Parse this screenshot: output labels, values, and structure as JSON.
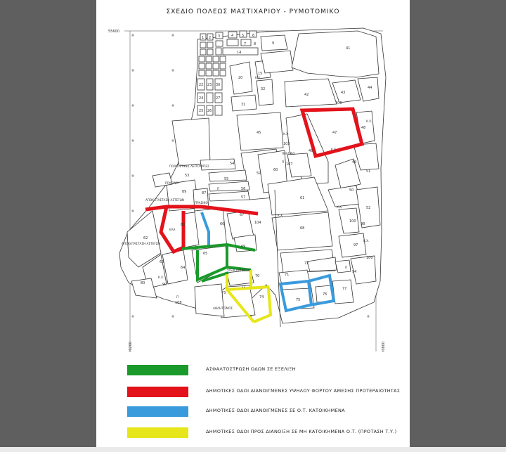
{
  "map": {
    "title": "ΣΧΕΔΙΟ ΠΟΛΕΩΣ ΜΑΣΤΙΧΑΡΙΟΥ   -   ΡΥΜΟΤΟΜΙΚΟ",
    "coord_top_left": "55600",
    "coord_bottom_left": "290200",
    "coord_bottom_right": "290800",
    "labels": {
      "politistiko": "ΠΟΛΙΤΙΣΤΙΚΕΣ ΛΕΙΤΟΥΡΓΙΕΣ",
      "prasino": "ΠΡΑΣΙΝΟ",
      "apokatastasi": "ΑΠΟΚΑΤΑΣΤΑΣΗ ΑΣΤΕΓΩΝ",
      "apokatastasi2": "ΑΠΟΚΑΤΑΣΤΑΣΗ ΑΣΤΕΓΩΝ",
      "ela": "ΕΛΑ",
      "ygeia": "ΥΓΕΙΑ ΠΡΟΝΟΙΑ",
      "athlitismos": "ΑΘΛΗΤΙΣΜΟΣ",
      "kx": "Κ.Χ.",
      "p": "Π"
    },
    "blocks": [
      "1",
      "2",
      "3",
      "4",
      "5",
      "6",
      "7",
      "8",
      "9",
      "14",
      "15",
      "20",
      "22",
      "23",
      "24",
      "25",
      "26",
      "27",
      "30",
      "31",
      "32",
      "41",
      "42",
      "43",
      "44",
      "45",
      "46",
      "47",
      "48",
      "49",
      "50",
      "51",
      "52",
      "53",
      "54",
      "55",
      "56",
      "57",
      "58",
      "59",
      "60",
      "61",
      "62",
      "63",
      "64",
      "65",
      "66",
      "67",
      "68",
      "69",
      "70",
      "71",
      "72",
      "73",
      "74",
      "75",
      "76",
      "77",
      "80",
      "86",
      "87",
      "89",
      "90",
      "94",
      "97",
      "98",
      "100",
      "103",
      "104",
      "106",
      "107",
      "108"
    ]
  },
  "legend": [
    {
      "color": "#1a9a2a",
      "text": "ΑΣΦΑΛΤΟΣΤΡΩΣΗ ΟΔΩΝ ΣΕ ΕΞΕΛΙΞΗ"
    },
    {
      "color": "#e3121b",
      "text": "ΔΗΜΟΤΙΚΕΣ ΟΔΟΙ ΔΙΑΝΟΙΓΜΕΝΕΣ ΥΨΗΛΟΥ ΦΟΡΤΟΥ ΑΜΕΣΗΣ ΠΡΟΤΕΡΑΙΟΤΗΤΑΣ"
    },
    {
      "color": "#3a9bdc",
      "text": "ΔΗΜΟΤΙΚΕΣ ΟΔΟΙ ΔΙΑΝΟΙΓΜΕΝΕΣ ΣΕ Ο.Τ. ΚΑΤΟΙΚΗΜΕΝΑ"
    },
    {
      "color": "#e6e61a",
      "text": "ΔΗΜΟΤΙΚΕΣ ΟΔΟΙ ΠΡΟΣ ΔΙΑΝΟΙΞΗ ΣΕ ΜΗ ΚΑΤΟΙΚΗΜΕΝΑ Ο.Τ. (ΠΡΟΤΑΣΗ Τ.Υ.)"
    }
  ]
}
